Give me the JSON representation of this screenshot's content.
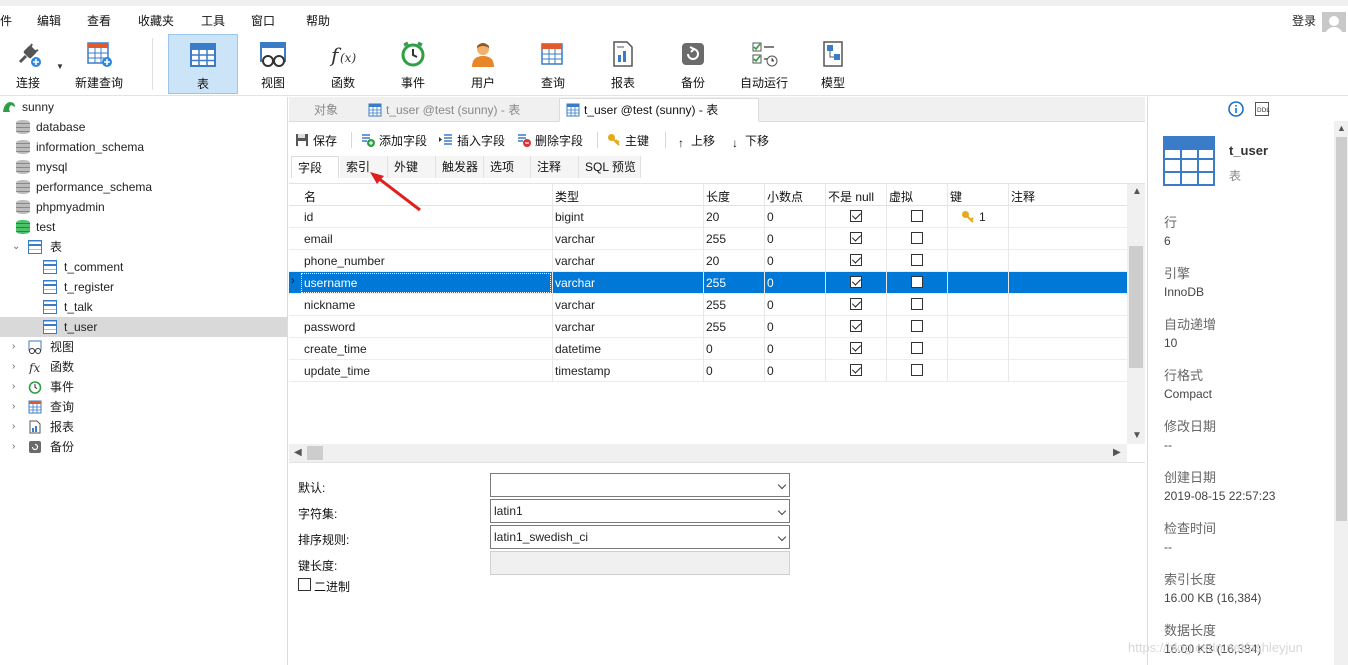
{
  "menu": {
    "items": [
      "件",
      "编辑",
      "查看",
      "收藏夹",
      "工具",
      "窗口",
      "帮助"
    ],
    "login": "登录"
  },
  "toolbar": {
    "buttons": [
      {
        "label": "连接",
        "icon": "plug-icon"
      },
      {
        "label": "新建查询",
        "icon": "new-query-icon"
      },
      {
        "label": "表",
        "icon": "table-icon"
      },
      {
        "label": "视图",
        "icon": "view-icon"
      },
      {
        "label": "函数",
        "icon": "function-icon"
      },
      {
        "label": "事件",
        "icon": "clock-icon"
      },
      {
        "label": "用户",
        "icon": "user-icon"
      },
      {
        "label": "查询",
        "icon": "query-icon"
      },
      {
        "label": "报表",
        "icon": "report-icon"
      },
      {
        "label": "备份",
        "icon": "backup-icon"
      },
      {
        "label": "自动运行",
        "icon": "autorun-icon"
      },
      {
        "label": "模型",
        "icon": "model-icon"
      }
    ],
    "active": "表"
  },
  "tree": {
    "connection": "sunny",
    "databases": [
      "database",
      "information_schema",
      "mysql",
      "performance_schema",
      "phpmyadmin",
      "test"
    ],
    "tables_group": "表",
    "tables": [
      "t_comment",
      "t_register",
      "t_talk",
      "t_user"
    ],
    "selected_table": "t_user",
    "groups": [
      "视图",
      "函数",
      "事件",
      "查询",
      "报表",
      "备份"
    ]
  },
  "tabs": [
    {
      "label": "对象"
    },
    {
      "label": "t_user @test (sunny) - 表"
    },
    {
      "label": "t_user @test (sunny) - 表"
    }
  ],
  "editor_toolbar": {
    "save": "保存",
    "add_field": "添加字段",
    "insert_field": "插入字段",
    "delete_field": "删除字段",
    "primary_key": "主键",
    "move_up": "上移",
    "move_down": "下移"
  },
  "subtabs": [
    "字段",
    "索引",
    "外键",
    "触发器",
    "选项",
    "注释",
    "SQL 预览"
  ],
  "grid": {
    "headers": [
      "名",
      "类型",
      "长度",
      "小数点",
      "不是 null",
      "虚拟",
      "键",
      "注释"
    ],
    "rows": [
      {
        "name": "id",
        "type": "bigint",
        "length": "20",
        "decimals": "0",
        "not_null": true,
        "virtual": false,
        "key": "1"
      },
      {
        "name": "email",
        "type": "varchar",
        "length": "255",
        "decimals": "0",
        "not_null": true,
        "virtual": false,
        "key": ""
      },
      {
        "name": "phone_number",
        "type": "varchar",
        "length": "20",
        "decimals": "0",
        "not_null": true,
        "virtual": false,
        "key": ""
      },
      {
        "name": "username",
        "type": "varchar",
        "length": "255",
        "decimals": "0",
        "not_null": true,
        "virtual": false,
        "key": ""
      },
      {
        "name": "nickname",
        "type": "varchar",
        "length": "255",
        "decimals": "0",
        "not_null": true,
        "virtual": false,
        "key": ""
      },
      {
        "name": "password",
        "type": "varchar",
        "length": "255",
        "decimals": "0",
        "not_null": true,
        "virtual": false,
        "key": ""
      },
      {
        "name": "create_time",
        "type": "datetime",
        "length": "0",
        "decimals": "0",
        "not_null": true,
        "virtual": false,
        "key": ""
      },
      {
        "name": "update_time",
        "type": "timestamp",
        "length": "0",
        "decimals": "0",
        "not_null": true,
        "virtual": false,
        "key": ""
      }
    ],
    "selected_row": "username"
  },
  "properties": {
    "default_label": "默认:",
    "default_value": "",
    "charset_label": "字符集:",
    "charset_value": "latin1",
    "collation_label": "排序规则:",
    "collation_value": "latin1_swedish_ci",
    "key_length_label": "键长度:",
    "binary_label": "二进制"
  },
  "info": {
    "title": "t_user",
    "subtitle": "表",
    "fields": [
      {
        "key": "行",
        "value": "6"
      },
      {
        "key": "引擎",
        "value": "InnoDB"
      },
      {
        "key": "自动递增",
        "value": "10"
      },
      {
        "key": "行格式",
        "value": "Compact"
      },
      {
        "key": "修改日期",
        "value": "--"
      },
      {
        "key": "创建日期",
        "value": "2019-08-15 22:57:23"
      },
      {
        "key": "检查时间",
        "value": "--"
      },
      {
        "key": "索引长度",
        "value": "16.00 KB (16,384)"
      },
      {
        "key": "数据长度",
        "value": "16.00 KB (16,384)"
      }
    ]
  },
  "watermark": "https://blog.csdn.net/ashleyjun",
  "colors": {
    "selection": "#0078d7",
    "active_toolbar": "#cce4f7",
    "accent_blue": "#3a7cc7",
    "annotation_red": "#e0201f"
  }
}
